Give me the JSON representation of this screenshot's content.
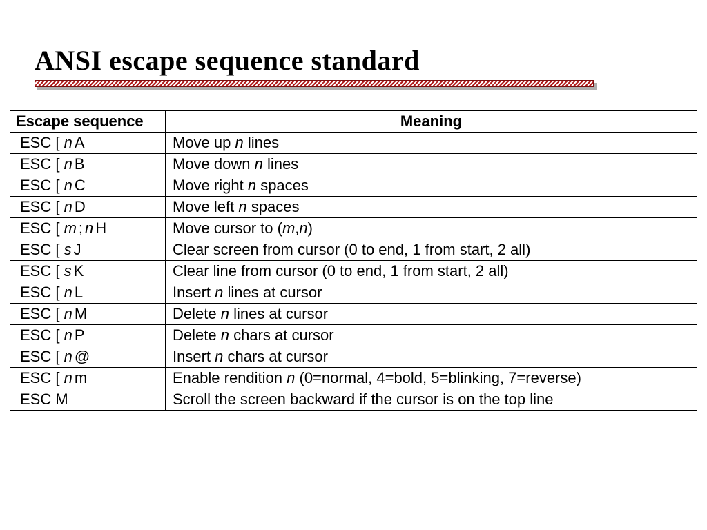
{
  "title": "ANSI escape sequence standard",
  "headers": {
    "sequence": "Escape sequence",
    "meaning": "Meaning"
  },
  "rows": [
    {
      "seq": [
        {
          "t": "ESC [ ",
          "it": false
        },
        {
          "t": "n",
          "it": true
        },
        {
          "t": "A",
          "it": false,
          "tight": true
        }
      ],
      "meaning": [
        {
          "t": "Move up ",
          "it": false
        },
        {
          "t": "n",
          "it": true
        },
        {
          "t": " lines",
          "it": false
        }
      ]
    },
    {
      "seq": [
        {
          "t": "ESC [ ",
          "it": false
        },
        {
          "t": "n",
          "it": true
        },
        {
          "t": "B",
          "it": false,
          "tight": true
        }
      ],
      "meaning": [
        {
          "t": "Move down ",
          "it": false
        },
        {
          "t": "n",
          "it": true
        },
        {
          "t": " lines",
          "it": false
        }
      ]
    },
    {
      "seq": [
        {
          "t": "ESC [ ",
          "it": false
        },
        {
          "t": "n",
          "it": true
        },
        {
          "t": "C",
          "it": false,
          "tight": true
        }
      ],
      "meaning": [
        {
          "t": "Move right ",
          "it": false
        },
        {
          "t": "n",
          "it": true
        },
        {
          "t": " spaces",
          "it": false
        }
      ]
    },
    {
      "seq": [
        {
          "t": "ESC [ ",
          "it": false
        },
        {
          "t": "n",
          "it": true
        },
        {
          "t": "D",
          "it": false,
          "tight": true
        }
      ],
      "meaning": [
        {
          "t": "Move left ",
          "it": false
        },
        {
          "t": "n",
          "it": true
        },
        {
          "t": " spaces",
          "it": false
        }
      ]
    },
    {
      "seq": [
        {
          "t": "ESC [ ",
          "it": false
        },
        {
          "t": "m",
          "it": true
        },
        {
          "t": ";",
          "it": false,
          "tight": true
        },
        {
          "t": "n",
          "it": true,
          "tight": true
        },
        {
          "t": "H",
          "it": false,
          "tight": true
        }
      ],
      "meaning": [
        {
          "t": "Move cursor to (",
          "it": false
        },
        {
          "t": "m",
          "it": true
        },
        {
          "t": ",",
          "it": false
        },
        {
          "t": "n",
          "it": true
        },
        {
          "t": ")",
          "it": false
        }
      ]
    },
    {
      "seq": [
        {
          "t": "ESC [ ",
          "it": false
        },
        {
          "t": "s",
          "it": true
        },
        {
          "t": "J",
          "it": false,
          "tight": true
        }
      ],
      "meaning": [
        {
          "t": "Clear screen from cursor (0 to end, 1 from start, 2 all)",
          "it": false
        }
      ]
    },
    {
      "seq": [
        {
          "t": "ESC [ ",
          "it": false
        },
        {
          "t": "s",
          "it": true
        },
        {
          "t": "K",
          "it": false,
          "tight": true
        }
      ],
      "meaning": [
        {
          "t": "Clear line from cursor (0 to end, 1 from start, 2 all)",
          "it": false
        }
      ]
    },
    {
      "seq": [
        {
          "t": "ESC [ ",
          "it": false
        },
        {
          "t": "n",
          "it": true
        },
        {
          "t": "L",
          "it": false,
          "tight": true
        }
      ],
      "meaning": [
        {
          "t": "Insert ",
          "it": false
        },
        {
          "t": "n",
          "it": true
        },
        {
          "t": " lines at cursor",
          "it": false
        }
      ]
    },
    {
      "seq": [
        {
          "t": "ESC [ ",
          "it": false
        },
        {
          "t": "n",
          "it": true
        },
        {
          "t": "M",
          "it": false,
          "tight": true
        }
      ],
      "meaning": [
        {
          "t": "Delete ",
          "it": false
        },
        {
          "t": "n",
          "it": true
        },
        {
          "t": " lines at cursor",
          "it": false
        }
      ]
    },
    {
      "seq": [
        {
          "t": "ESC [ ",
          "it": false
        },
        {
          "t": "n",
          "it": true
        },
        {
          "t": "P",
          "it": false,
          "tight": true
        }
      ],
      "meaning": [
        {
          "t": "Delete ",
          "it": false
        },
        {
          "t": "n",
          "it": true
        },
        {
          "t": " chars at cursor",
          "it": false
        }
      ]
    },
    {
      "seq": [
        {
          "t": "ESC [ ",
          "it": false
        },
        {
          "t": "n",
          "it": true
        },
        {
          "t": "@",
          "it": false,
          "tight": true
        }
      ],
      "meaning": [
        {
          "t": "Insert ",
          "it": false
        },
        {
          "t": "n",
          "it": true
        },
        {
          "t": " chars at cursor",
          "it": false
        }
      ]
    },
    {
      "seq": [
        {
          "t": "ESC [ ",
          "it": false
        },
        {
          "t": "n",
          "it": true
        },
        {
          "t": "m",
          "it": false,
          "tight": true
        }
      ],
      "meaning": [
        {
          "t": "Enable rendition ",
          "it": false
        },
        {
          "t": "n",
          "it": true
        },
        {
          "t": " (0=normal, 4=bold, 5=blinking, 7=reverse)",
          "it": false
        }
      ]
    },
    {
      "seq": [
        {
          "t": "ESC M",
          "it": false
        }
      ],
      "meaning": [
        {
          "t": "Scroll the screen backward if the cursor is on the top line",
          "it": false
        }
      ]
    }
  ]
}
